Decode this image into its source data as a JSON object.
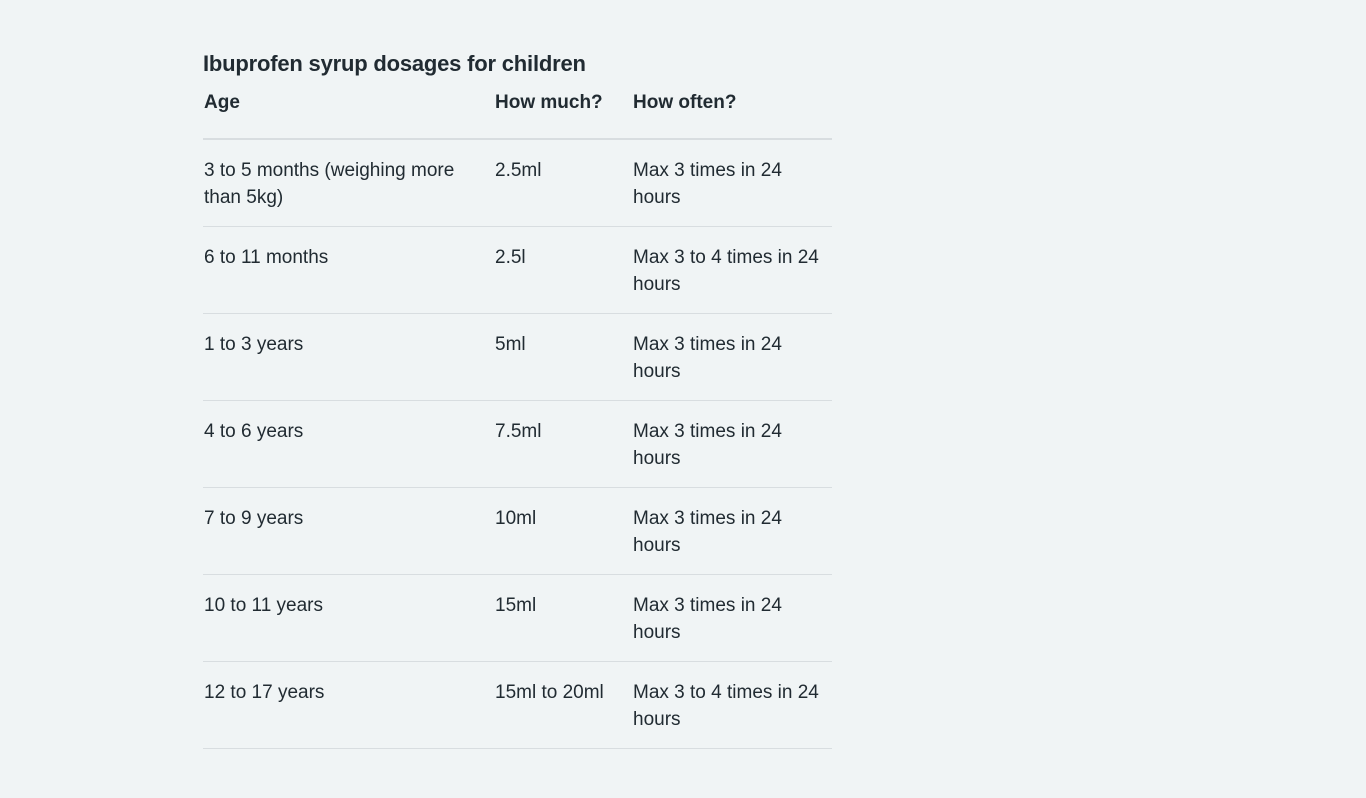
{
  "title": "Ibuprofen syrup dosages for children",
  "headers": {
    "age": "Age",
    "how_much": "How much?",
    "how_often": "How often?"
  },
  "rows": [
    {
      "age": "3 to 5 months (weighing more than 5kg)",
      "how_much": "2.5ml",
      "how_often": "Max 3 times in 24 hours"
    },
    {
      "age": "6 to 11 months",
      "how_much": "2.5l",
      "how_often": "Max 3 to 4 times in 24 hours"
    },
    {
      "age": "1 to 3 years",
      "how_much": "5ml",
      "how_often": "Max 3 times in 24 hours"
    },
    {
      "age": "4 to 6 years",
      "how_much": "7.5ml",
      "how_often": "Max 3 times in 24 hours"
    },
    {
      "age": "7 to 9 years",
      "how_much": "10ml",
      "how_often": "Max 3 times in 24 hours"
    },
    {
      "age": "10 to 11 years",
      "how_much": "15ml",
      "how_often": "Max 3 times in 24 hours"
    },
    {
      "age": "12 to 17 years",
      "how_much": "15ml to 20ml",
      "how_often": "Max 3 to 4 times in 24 hours"
    }
  ],
  "colors": {
    "background": "#f0f4f5",
    "text": "#212b32",
    "divider": "#d8dde0"
  }
}
